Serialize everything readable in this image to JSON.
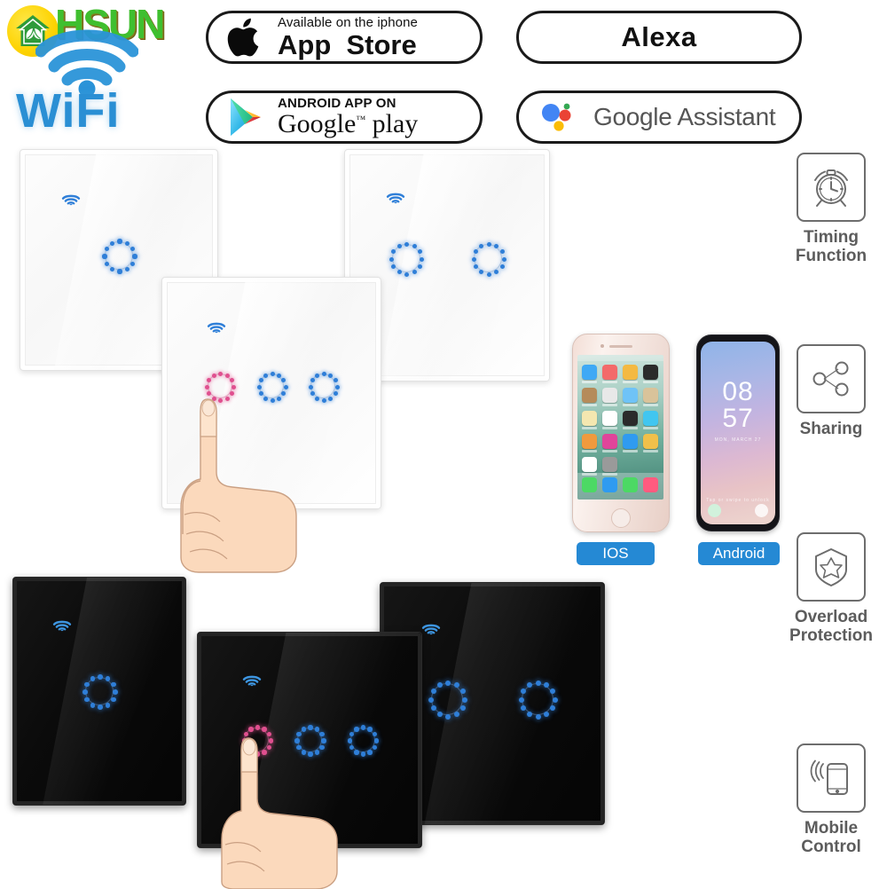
{
  "brand": {
    "name": "HSUN",
    "wifi_word": "WiFi",
    "logo_icon": "house-leaf-icon",
    "wifi_icon": "wifi-signal-icon",
    "accent_green": "#3fbf2f",
    "accent_yellow": "#fdd302",
    "accent_blue": "#2a8fd4"
  },
  "badges": {
    "app_store": {
      "icon": "apple-logo-icon",
      "line1": "Available on the iphone",
      "line2_a": "App",
      "line2_b": "Store"
    },
    "google_play": {
      "icon": "google-play-triangle-icon",
      "line1": "ANDROID APP ON",
      "line2_a": "Google",
      "line2_tm": "™",
      "line2_b": "play"
    },
    "alexa": {
      "label": "Alexa"
    },
    "google_assistant": {
      "icon": "google-assistant-dots-icon",
      "label": "Google Assistant"
    }
  },
  "switches": [
    {
      "id": "white-1-gang",
      "color": "white",
      "gangs": 1,
      "active_index": -1,
      "wifi_icon": "wifi-indicator-icon"
    },
    {
      "id": "white-2-gang",
      "color": "white",
      "gangs": 2,
      "active_index": -1,
      "wifi_icon": "wifi-indicator-icon"
    },
    {
      "id": "white-3-gang",
      "color": "white",
      "gangs": 3,
      "active_index": 0,
      "wifi_icon": "wifi-indicator-icon"
    },
    {
      "id": "black-1-gang",
      "color": "black",
      "gangs": 1,
      "active_index": -1,
      "wifi_icon": "wifi-indicator-icon"
    },
    {
      "id": "black-2-gang",
      "color": "black",
      "gangs": 2,
      "active_index": -1,
      "wifi_icon": "wifi-indicator-icon"
    },
    {
      "id": "black-3-gang",
      "color": "black",
      "gangs": 3,
      "active_index": 0,
      "wifi_icon": "wifi-indicator-icon"
    }
  ],
  "led_colors": {
    "on": "#e0508f",
    "off": "#2f7fd8"
  },
  "phones": {
    "ios": {
      "badge_label": "IOS",
      "device": "iphone-rose-gold",
      "screen": "ios-home-screen"
    },
    "android": {
      "badge_label": "Android",
      "device": "samsung-galaxy",
      "screen": "android-lock-screen",
      "time_hour": "08",
      "time_minute": "57"
    },
    "badge_color": "#2589d4"
  },
  "features": [
    {
      "icon": "alarm-clock-icon",
      "line1": "Timing",
      "line2": "Function"
    },
    {
      "icon": "share-nodes-icon",
      "line1": "Sharing",
      "line2": ""
    },
    {
      "icon": "shield-star-icon",
      "line1": "Overload",
      "line2": "Protection"
    },
    {
      "icon": "phone-signal-icon",
      "line1": "Mobile",
      "line2": "Control"
    }
  ],
  "hands": [
    {
      "name": "pointing-hand-white-switch"
    },
    {
      "name": "pointing-hand-black-switch"
    }
  ]
}
